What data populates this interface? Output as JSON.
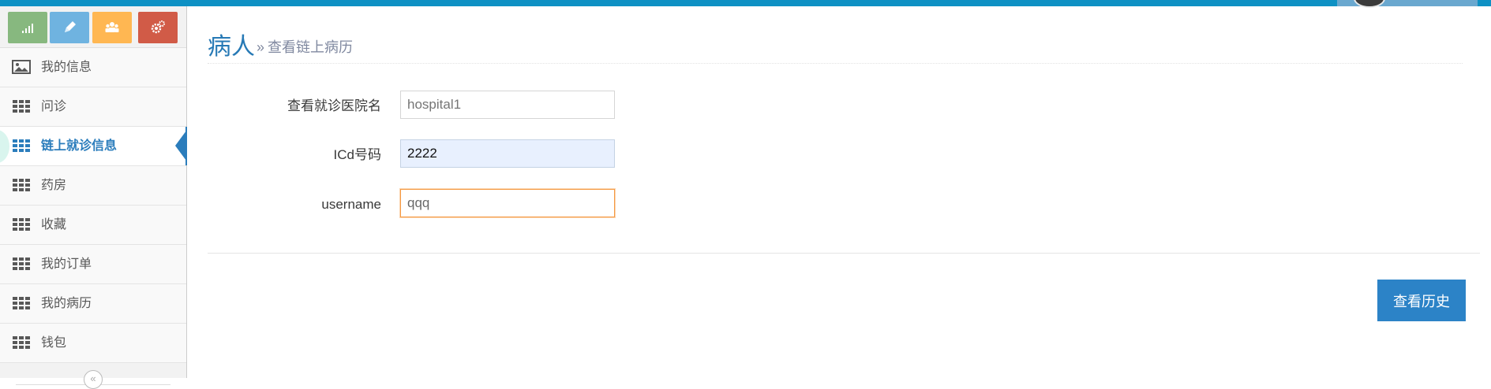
{
  "sidebar": {
    "shortcuts": [
      {
        "icon": "signal-icon",
        "color": "#87b87f"
      },
      {
        "icon": "pencil-icon",
        "color": "#6fb3e0"
      },
      {
        "icon": "group-icon",
        "color": "#ffb752"
      },
      {
        "icon": "cogs-icon",
        "color": "#d15b47"
      }
    ],
    "items": [
      {
        "label": "我的信息",
        "icon": "picture-icon",
        "active": false
      },
      {
        "label": "问诊",
        "icon": "grid-icon",
        "active": false
      },
      {
        "label": "链上就诊信息",
        "icon": "grid-icon",
        "active": true
      },
      {
        "label": "药房",
        "icon": "grid-icon",
        "active": false
      },
      {
        "label": "收藏",
        "icon": "grid-icon",
        "active": false
      },
      {
        "label": "我的订单",
        "icon": "grid-icon",
        "active": false
      },
      {
        "label": "我的病历",
        "icon": "grid-icon",
        "active": false
      },
      {
        "label": "钱包",
        "icon": "grid-icon",
        "active": false
      }
    ],
    "collapse_icon": "«"
  },
  "header": {
    "title": "病人",
    "separator": "»",
    "subtitle": "查看链上病历"
  },
  "form": {
    "hospital": {
      "label": "查看就诊医院名",
      "placeholder": "hospital1",
      "value": ""
    },
    "icd": {
      "label": "ICd号码",
      "value": "2222"
    },
    "username": {
      "label": "username",
      "value": "qqq"
    }
  },
  "actions": {
    "view_history_label": "查看历史"
  },
  "colors": {
    "topbar": "#0e91c4",
    "accent": "#2b7dbc",
    "button": "#2c83c7",
    "focus_border": "#f59942"
  }
}
